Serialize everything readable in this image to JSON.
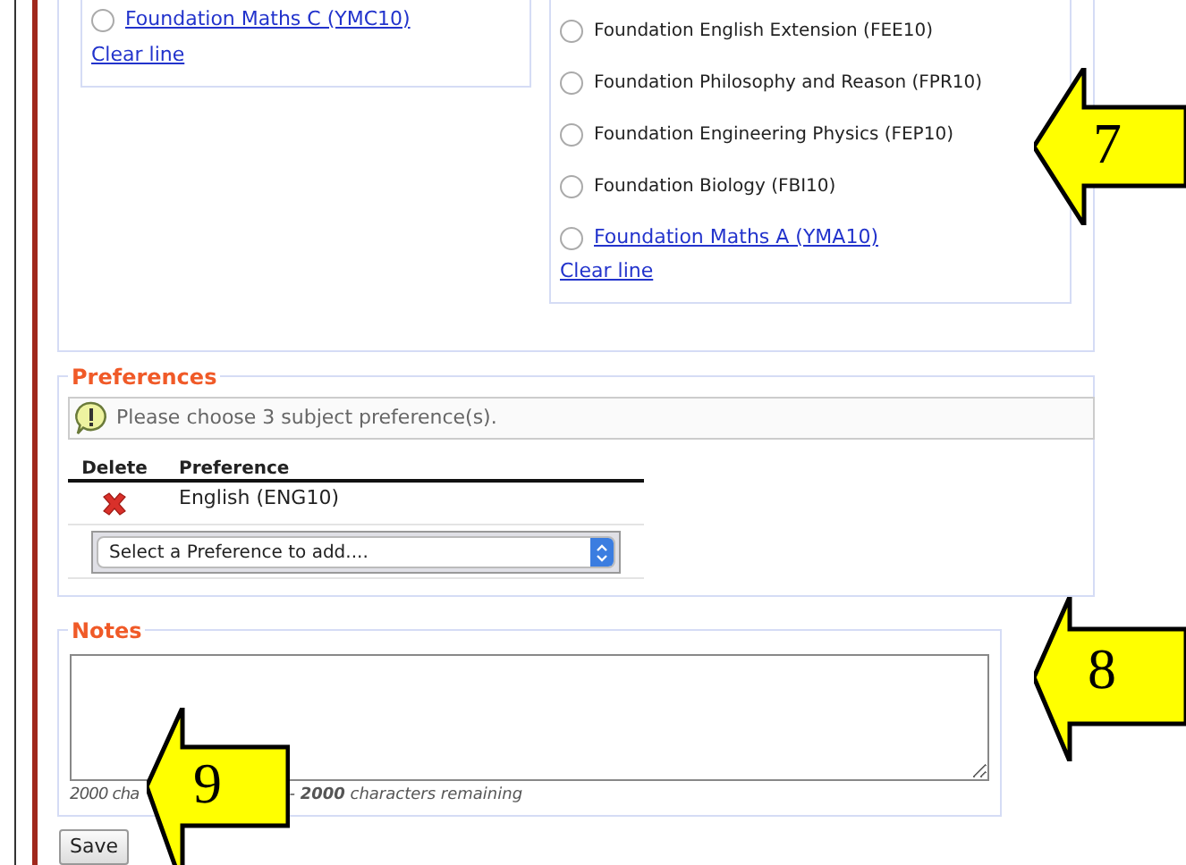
{
  "subject_groups": [
    {
      "options": [
        {
          "label": "Foundation Maths C (YMC10)",
          "kind": "link",
          "selected": false
        }
      ],
      "clear_link": "Clear line"
    },
    {
      "options": [
        {
          "label": "Foundation English Extension (FEE10)",
          "kind": "text",
          "selected": false
        },
        {
          "label": "Foundation Philosophy and Reason (FPR10)",
          "kind": "text",
          "selected": false
        },
        {
          "label": "Foundation Engineering Physics (FEP10)",
          "kind": "text",
          "selected": false
        },
        {
          "label": "Foundation Biology (FBI10)",
          "kind": "text",
          "selected": false
        },
        {
          "label": "Foundation Maths A (YMA10)",
          "kind": "link",
          "selected": false
        }
      ],
      "clear_link": "Clear line"
    }
  ],
  "preferences": {
    "legend": "Preferences",
    "notice": "Please choose 3 subject preference(s).",
    "columns": [
      "Delete",
      "Preference"
    ],
    "rows": [
      {
        "preference": "English (ENG10)"
      }
    ],
    "select": {
      "value": "Select a Preference to add...."
    }
  },
  "notes": {
    "legend": "Notes",
    "counter_start": "2000 cha",
    "counter_end": "- **2000** characters remaining"
  },
  "save_button": "Save",
  "callouts": [
    {
      "number": "7"
    },
    {
      "number": "8"
    },
    {
      "number": "9"
    }
  ]
}
